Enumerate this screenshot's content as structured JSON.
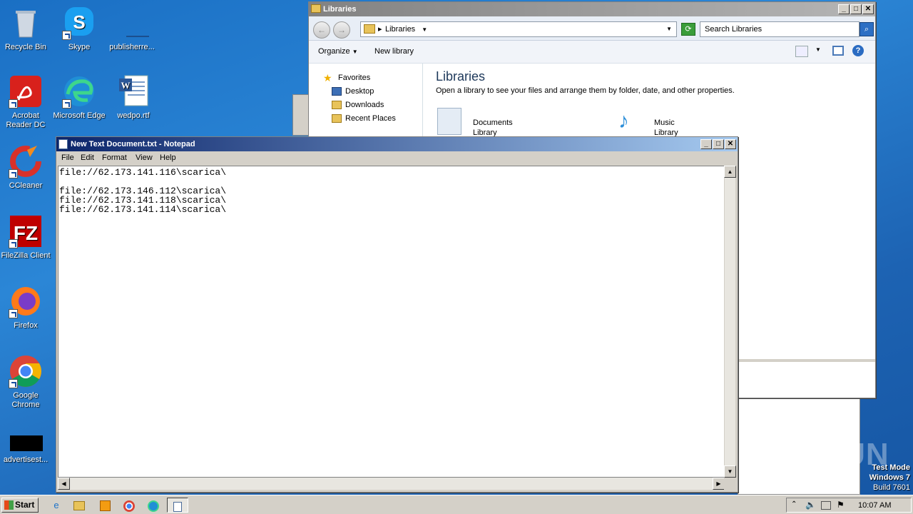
{
  "desktop": {
    "icons": [
      {
        "label": "Recycle Bin",
        "icon": "recycle-bin-icon"
      },
      {
        "label": "Skype",
        "icon": "skype-icon"
      },
      {
        "label": "publisherre...",
        "icon": "file-icon"
      },
      {
        "label": "Acrobat Reader DC",
        "icon": "acrobat-icon"
      },
      {
        "label": "Microsoft Edge",
        "icon": "edge-icon"
      },
      {
        "label": "wedpo.rtf",
        "icon": "word-doc-icon"
      },
      {
        "label": "CCleaner",
        "icon": "ccleaner-icon"
      },
      {
        "label": "FileZilla Client",
        "icon": "filezilla-icon"
      },
      {
        "label": "Firefox",
        "icon": "firefox-icon"
      },
      {
        "label": "Google Chrome",
        "icon": "chrome-icon"
      },
      {
        "label": "advertisest...",
        "icon": "file-icon"
      }
    ]
  },
  "explorer": {
    "title": "Libraries",
    "address_crumb": "Libraries",
    "search_placeholder": "Search Libraries",
    "commands": {
      "organize": "Organize",
      "new_library": "New library"
    },
    "nav": {
      "favorites": "Favorites",
      "items": [
        "Desktop",
        "Downloads",
        "Recent Places"
      ]
    },
    "heading": "Libraries",
    "subtitle": "Open a library to see your files and arrange them by folder, date, and other properties.",
    "libraries": [
      {
        "name": "Documents",
        "type": "Library"
      },
      {
        "name": "Music",
        "type": "Library"
      }
    ]
  },
  "notepad": {
    "title": "New Text Document.txt - Notepad",
    "menu": [
      "File",
      "Edit",
      "Format",
      "View",
      "Help"
    ],
    "content": "file://62.173.141.116\\scarica\\\n\nfile://62.173.146.112\\scarica\\\nfile://62.173.141.118\\scarica\\\nfile://62.173.141.114\\scarica\\"
  },
  "taskbar": {
    "start_label": "Start",
    "clock": "10:07 AM"
  },
  "watermark": {
    "line1": "Test Mode",
    "line2": "Windows 7",
    "line3": "Build 7601",
    "brand": "ANY RUN"
  }
}
